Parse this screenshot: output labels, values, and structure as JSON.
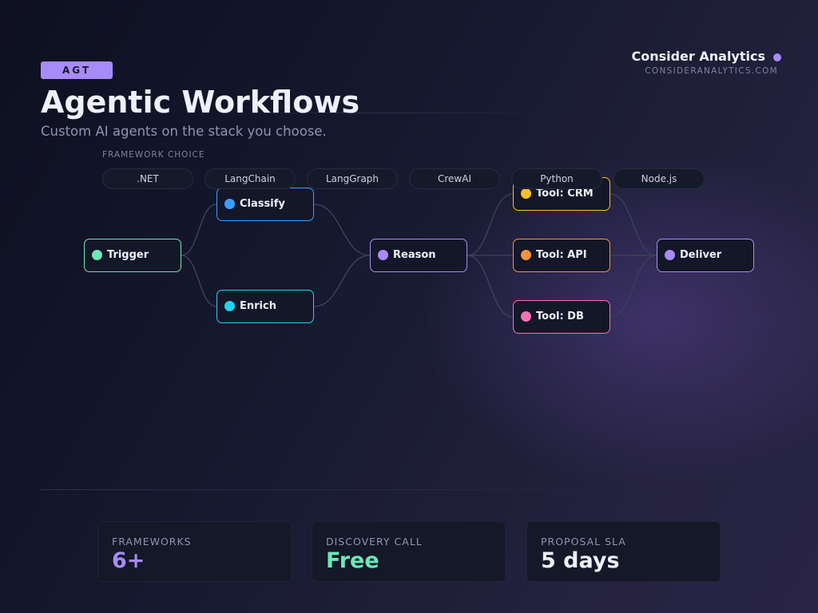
{
  "header": {
    "badge": "AGT",
    "title": "Agentic Workflows",
    "subtitle": "Custom AI agents on the stack you choose.",
    "brand_name": "Consider Analytics",
    "brand_url": "CONSIDERANALYTICS.COM",
    "accent_color": "#a78bfa"
  },
  "frameworks": {
    "label": "FRAMEWORK CHOICE",
    "items": [
      ".NET",
      "LangChain",
      "LangGraph",
      "CrewAI",
      "Python",
      "Node.js"
    ]
  },
  "workflow": {
    "nodes": {
      "trigger": {
        "label": "Trigger",
        "color": "#6ee7b7"
      },
      "classify": {
        "label": "Classify",
        "color": "#3b9eff"
      },
      "enrich": {
        "label": "Enrich",
        "color": "#22d3ee"
      },
      "reason": {
        "label": "Reason",
        "color": "#a78bfa"
      },
      "tool_crm": {
        "label": "Tool: CRM",
        "color": "#fbbf24"
      },
      "tool_api": {
        "label": "Tool: API",
        "color": "#fb923c"
      },
      "tool_db": {
        "label": "Tool: DB",
        "color": "#f472b6"
      },
      "deliver": {
        "label": "Deliver",
        "color": "#a78bfa"
      }
    },
    "edges": [
      [
        "trigger",
        "classify"
      ],
      [
        "trigger",
        "enrich"
      ],
      [
        "classify",
        "reason"
      ],
      [
        "enrich",
        "reason"
      ],
      [
        "reason",
        "tool_crm"
      ],
      [
        "reason",
        "tool_api"
      ],
      [
        "reason",
        "tool_db"
      ],
      [
        "tool_crm",
        "deliver"
      ],
      [
        "tool_api",
        "deliver"
      ],
      [
        "tool_db",
        "deliver"
      ]
    ]
  },
  "stats": [
    {
      "label": "FRAMEWORKS",
      "value": "6+",
      "color": "#a78bfa"
    },
    {
      "label": "DISCOVERY CALL",
      "value": "Free",
      "color": "#6ee7b7"
    },
    {
      "label": "PROPOSAL SLA",
      "value": "5 days",
      "color": "#eef0fa"
    }
  ]
}
